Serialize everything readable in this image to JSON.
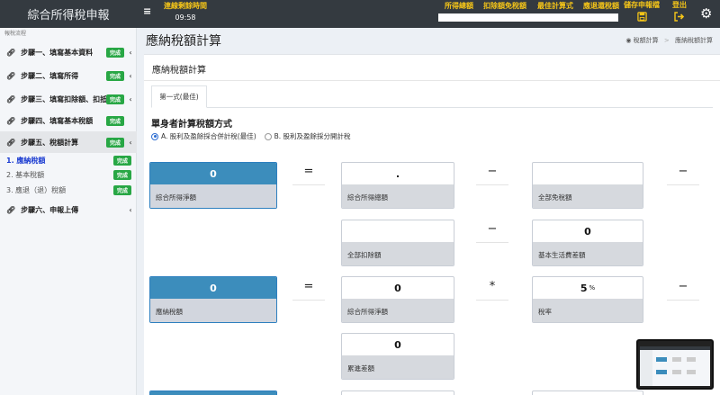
{
  "app": {
    "title": "綜合所得稅申報"
  },
  "topbar": {
    "menu_icon": "hamburger-icon",
    "timer_label": "連線剩餘時間",
    "timer_value": "09:58",
    "nav": [
      "所得總額",
      "扣除額免稅額",
      "最佳計算式",
      "應退還稅額"
    ],
    "save_label": "儲存申報檔",
    "logout_label": "登出"
  },
  "sidebar": {
    "caption": "報稅流程",
    "steps": [
      {
        "label": "步驟一、填寫基本資料",
        "badge": "完成"
      },
      {
        "label": "步驟二、填寫所得",
        "badge": "完成"
      },
      {
        "label": "步驟三、填寫扣除額、扣抵",
        "badge": "完成"
      },
      {
        "label": "步驟四、填寫基本稅額",
        "badge": "完成"
      },
      {
        "label": "步驟五、稅額計算",
        "badge": "完成"
      },
      {
        "label": "步驟六、申報上傳",
        "badge": ""
      }
    ],
    "subitems": [
      {
        "label": "1. 應納稅額",
        "badge": "完成"
      },
      {
        "label": "2. 基本稅額",
        "badge": "完成"
      },
      {
        "label": "3. 應退（退）稅額",
        "badge": "完成"
      }
    ]
  },
  "page": {
    "title": "應納稅額計算",
    "breadcrumb": [
      "稅額計算",
      "應納稅額計算"
    ],
    "card_title": "應納稅額計算",
    "tab": "第一式(最佳)",
    "section_heading": "單身者計算稅額方式",
    "radio_a": "A. 股利及盈餘採合併計稅(最佳)",
    "radio_b": "B. 股利及盈餘採分開計稅"
  },
  "formula": {
    "net_income_box": {
      "value": "0",
      "label": "綜合所得淨額"
    },
    "gross_income_box": {
      "value": ".",
      "label": "綜合所得總額"
    },
    "exemption_box": {
      "value": "",
      "label": "全部免稅額"
    },
    "deduction_box": {
      "value": "",
      "label": "全部扣除額"
    },
    "basic_living_box": {
      "value": "0",
      "label": "基本生活費差額"
    },
    "tax_payable_box": {
      "value": "0",
      "label": "應納稅額"
    },
    "net_income2_box": {
      "value": "0",
      "label": "綜合所得淨額"
    },
    "tax_rate_box": {
      "value": "5",
      "unit": "%",
      "label": "稅率"
    },
    "progressive_box": {
      "value": "0",
      "label": "累進差額"
    },
    "operators": {
      "eq": "=",
      "minus": "−",
      "times": "*"
    }
  }
}
